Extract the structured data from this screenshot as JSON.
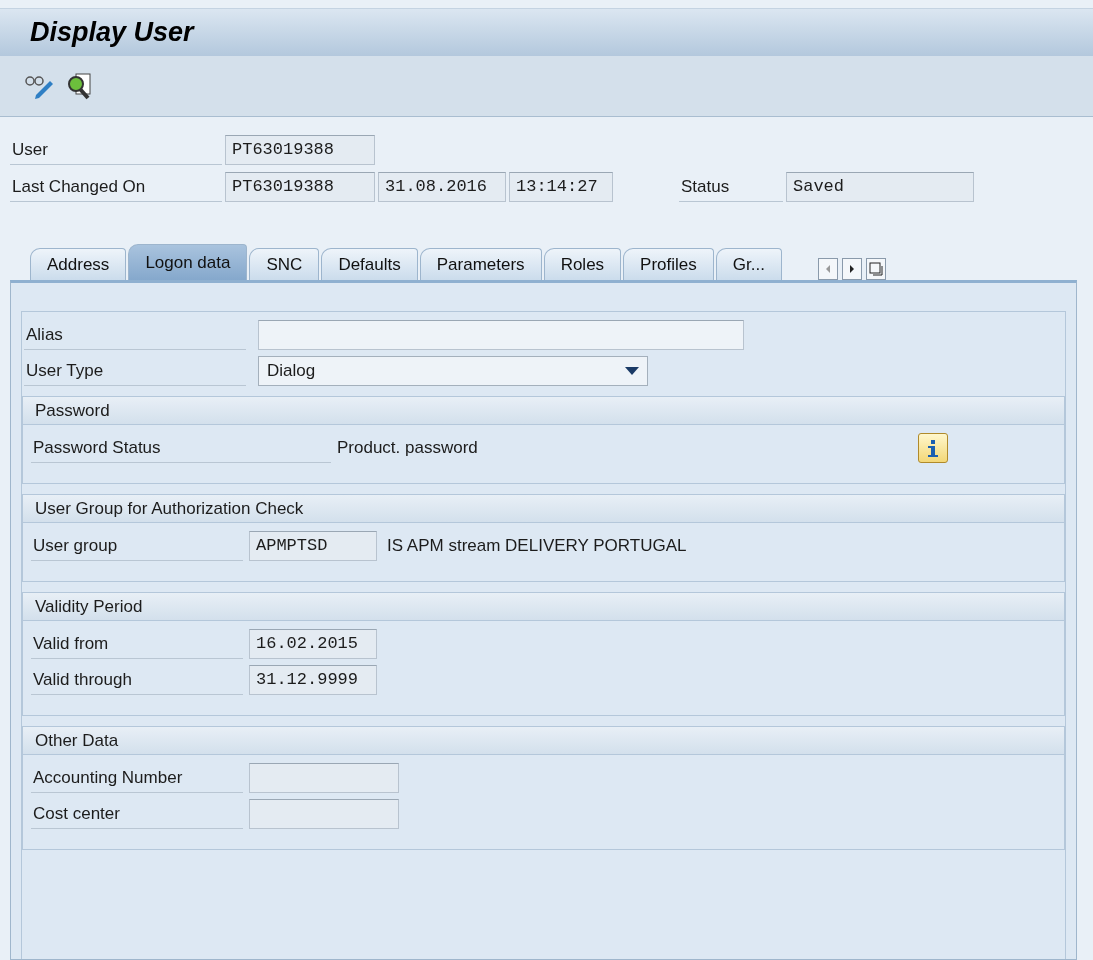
{
  "window": {
    "title": "Display User"
  },
  "toolbar": [
    {
      "kind": "glasses-pencil"
    },
    {
      "kind": "magnifier-doc"
    }
  ],
  "header": {
    "user": {
      "label": "User",
      "value": "PT63019388"
    },
    "last_changed": {
      "label": "Last Changed On",
      "by": "PT63019388",
      "date": "31.08.2016",
      "time": "13:14:27"
    },
    "status": {
      "label": "Status",
      "value": "Saved"
    }
  },
  "tabs": [
    {
      "label": "Address",
      "selected": false
    },
    {
      "label": "Logon data",
      "selected": true
    },
    {
      "label": "SNC",
      "selected": false
    },
    {
      "label": "Defaults",
      "selected": false
    },
    {
      "label": "Parameters",
      "selected": false
    },
    {
      "label": "Roles",
      "selected": false
    },
    {
      "label": "Profiles",
      "selected": false
    },
    {
      "label": "Gr...",
      "selected": false
    }
  ],
  "tab_controls": [
    {
      "kind": "left"
    },
    {
      "kind": "right"
    },
    {
      "kind": "list"
    }
  ],
  "logon": {
    "alias": {
      "label": "Alias"
    },
    "user_type": {
      "label": "User Type",
      "value": "Dialog"
    }
  },
  "sections": [
    {
      "title": "Password",
      "rows": [
        {
          "kind": "text",
          "label": "Password Status",
          "value": "Product. password",
          "info": true
        }
      ]
    },
    {
      "title": "User Group for Authorization Check",
      "rows": [
        {
          "kind": "field",
          "label": "User group",
          "value": "APMPTSD",
          "note": "IS APM stream DELIVERY PORTUGAL"
        }
      ]
    },
    {
      "title": "Validity Period",
      "rows": [
        {
          "kind": "field",
          "label": "Valid from",
          "value": "16.02.2015"
        },
        {
          "kind": "field",
          "label": "Valid through",
          "value": "31.12.9999"
        }
      ]
    },
    {
      "title": "Other Data",
      "rows": [
        {
          "kind": "field",
          "label": "Accounting Number"
        },
        {
          "kind": "field",
          "label": "Cost center"
        }
      ]
    }
  ]
}
